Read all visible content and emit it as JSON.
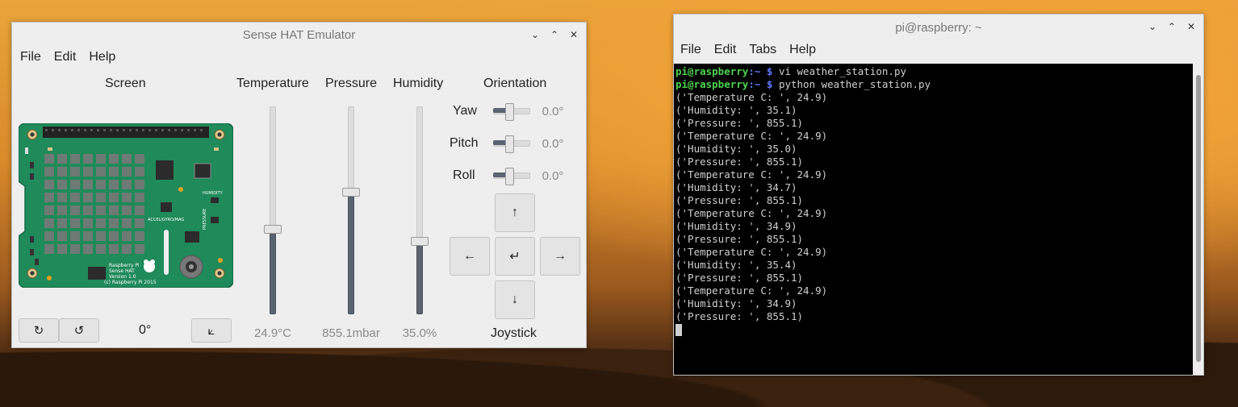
{
  "sense_window": {
    "title": "Sense HAT Emulator",
    "menu": [
      "File",
      "Edit",
      "Help"
    ],
    "screen_label": "Screen",
    "board": {
      "line1": "Raspberry Pi",
      "line2": "Sense HAT",
      "line3": "Version 1.0",
      "line4": "(c) Raspberry Pi 2015",
      "accel": "ACCEL/GYRO/MAG",
      "humidity": "HUMIDITY",
      "pressure": "PRESSURE"
    },
    "rotate_cw": "↻",
    "rotate_ccw": "↺",
    "rotation_value": "0°",
    "flip_label": "⟀",
    "temperature": {
      "label": "Temperature",
      "value": "24.9°C",
      "level": 0.41
    },
    "pressure": {
      "label": "Pressure",
      "value": "855.1mbar",
      "level": 0.59
    },
    "humidity": {
      "label": "Humidity",
      "value": "35.0%",
      "level": 0.35
    },
    "orientation": {
      "label": "Orientation",
      "yaw": {
        "label": "Yaw",
        "value": "0.0°"
      },
      "pitch": {
        "label": "Pitch",
        "value": "0.0°"
      },
      "roll": {
        "label": "Roll",
        "value": "0.0°"
      }
    },
    "joystick": {
      "label": "Joystick",
      "up": "↑",
      "down": "↓",
      "left": "←",
      "right": "→",
      "enter": "↵"
    }
  },
  "terminal": {
    "title": "pi@raspberry: ~",
    "menu": [
      "File",
      "Edit",
      "Tabs",
      "Help"
    ],
    "prompt_user": "pi@raspberry",
    "prompt_path": ":~ $",
    "commands": [
      "vi weather_station.py",
      "python weather_station.py"
    ],
    "output": [
      "('Temperature C: ', 24.9)",
      "('Humidity: ', 35.1)",
      "('Pressure: ', 855.1)",
      "('Temperature C: ', 24.9)",
      "('Humidity: ', 35.0)",
      "('Pressure: ', 855.1)",
      "('Temperature C: ', 24.9)",
      "('Humidity: ', 34.7)",
      "('Pressure: ', 855.1)",
      "('Temperature C: ', 24.9)",
      "('Humidity: ', 34.9)",
      "('Pressure: ', 855.1)",
      "('Temperature C: ', 24.9)",
      "('Humidity: ', 35.4)",
      "('Pressure: ', 855.1)",
      "('Temperature C: ', 24.9)",
      "('Humidity: ', 34.9)",
      "('Pressure: ', 855.1)"
    ]
  },
  "window_controls": {
    "minimize": "⌄",
    "maximize": "⌃",
    "close": "✕"
  }
}
